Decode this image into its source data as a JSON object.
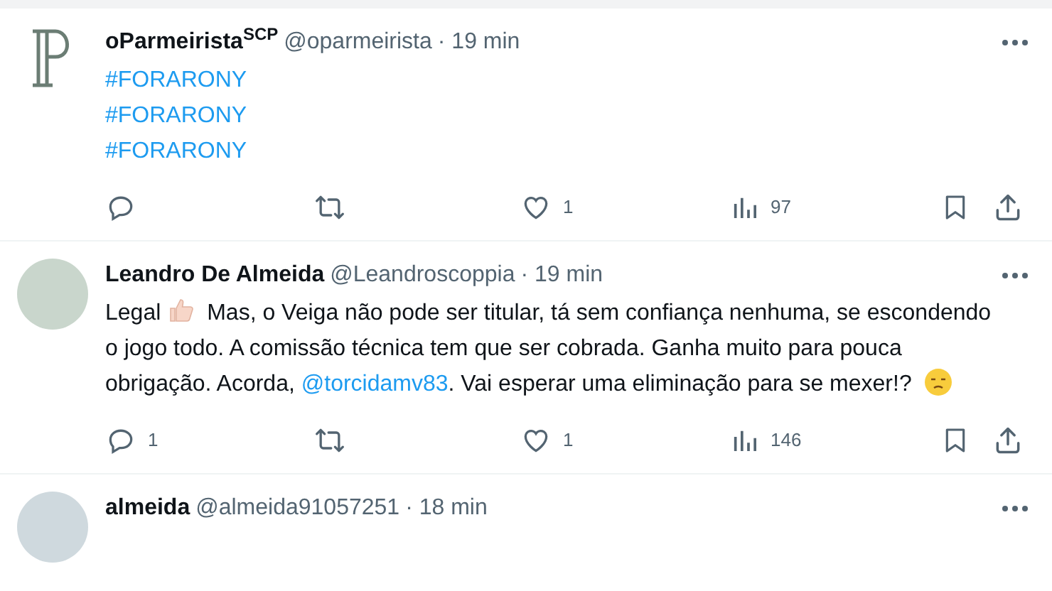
{
  "tweets": [
    {
      "avatar": {
        "kind": "logo"
      },
      "name": "oParmeirista$^{SCP}$",
      "handle": "@oparmeirista",
      "time": "· 19 min",
      "body": [
        {
          "kind": "hashtag",
          "text": "#FORARONY"
        },
        {
          "kind": "break"
        },
        {
          "kind": "hashtag",
          "text": "#FORARONY"
        },
        {
          "kind": "break"
        },
        {
          "kind": "hashtag",
          "text": "#FORARONY"
        }
      ],
      "likes": "1",
      "views": "97"
    },
    {
      "avatar": {
        "kind": "photo"
      },
      "name": "Leandro De Almeida",
      "handle": "@Leandroscoppia",
      "time": "· 19 min",
      "body": [
        {
          "kind": "text",
          "text": "Legal"
        },
        {
          "kind": "thumbs"
        },
        {
          "kind": "text",
          "text": "Mas, o Veiga não pode ser titular, tá sem confiança nenhuma, se escondendo o jogo todo. A comissão técnica tem que ser cobrada. Ganha muito para pouca obrigação. Acorda,"
        },
        {
          "kind": "mention",
          "text": "@torcidamv83"
        },
        {
          "kind": "text",
          "text": ". Vai esperar uma eliminação para se mexer!?"
        },
        {
          "kind": "face"
        }
      ],
      "replies": "1",
      "likes": "1",
      "views": "146"
    },
    {
      "avatar": {
        "kind": "default"
      },
      "name": "almeida",
      "handle": "@almeida91057251",
      "time": "· 18 min"
    }
  ]
}
